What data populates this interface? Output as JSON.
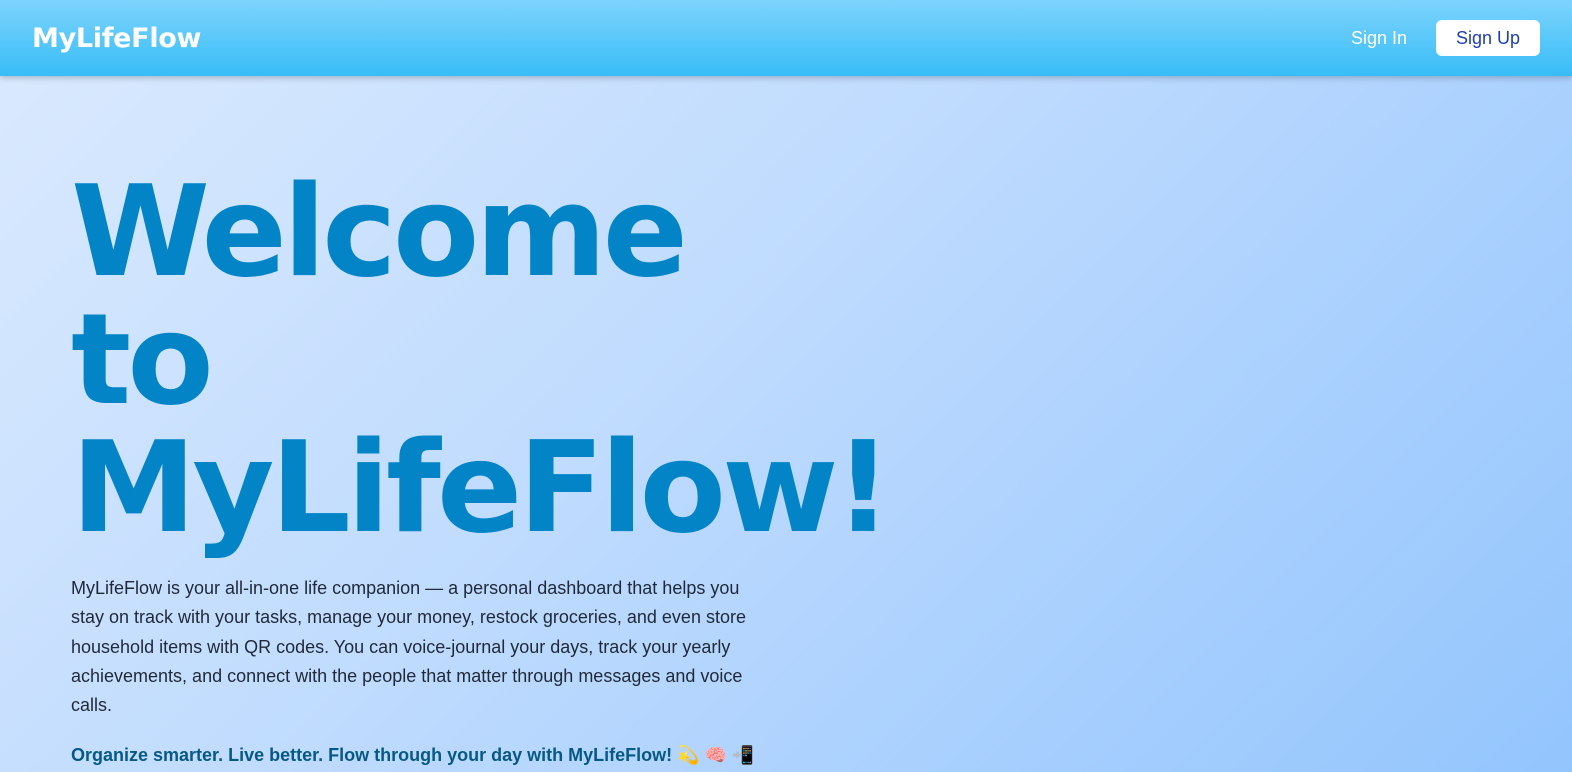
{
  "navbar": {
    "brand": "MyLifeFlow",
    "sign_in_label": "Sign In",
    "sign_up_label": "Sign Up"
  },
  "hero": {
    "title_lines": [
      "Welcome",
      "to",
      "MyLifeFlow!"
    ],
    "description": "MyLifeFlow is your all-in-one life companion — a personal dashboard that helps you stay on track with your tasks, manage your money, restock groceries, and even store household items with QR codes. You can voice-journal your days, track your yearly achievements, and connect with the people that matter through messages and voice calls.",
    "tagline": "Organize smarter. Live better. Flow through your day with MyLifeFlow! 💫 🧠 📲"
  },
  "colors": {
    "navbar_gradient_start": "#7dd3fc",
    "navbar_gradient_end": "#38bdf8",
    "title_color": "#0284c7",
    "tagline_color": "#075985",
    "signup_text_color": "#1e40af",
    "background_light": "#dbeafe",
    "background_dark": "#93c5fd"
  }
}
